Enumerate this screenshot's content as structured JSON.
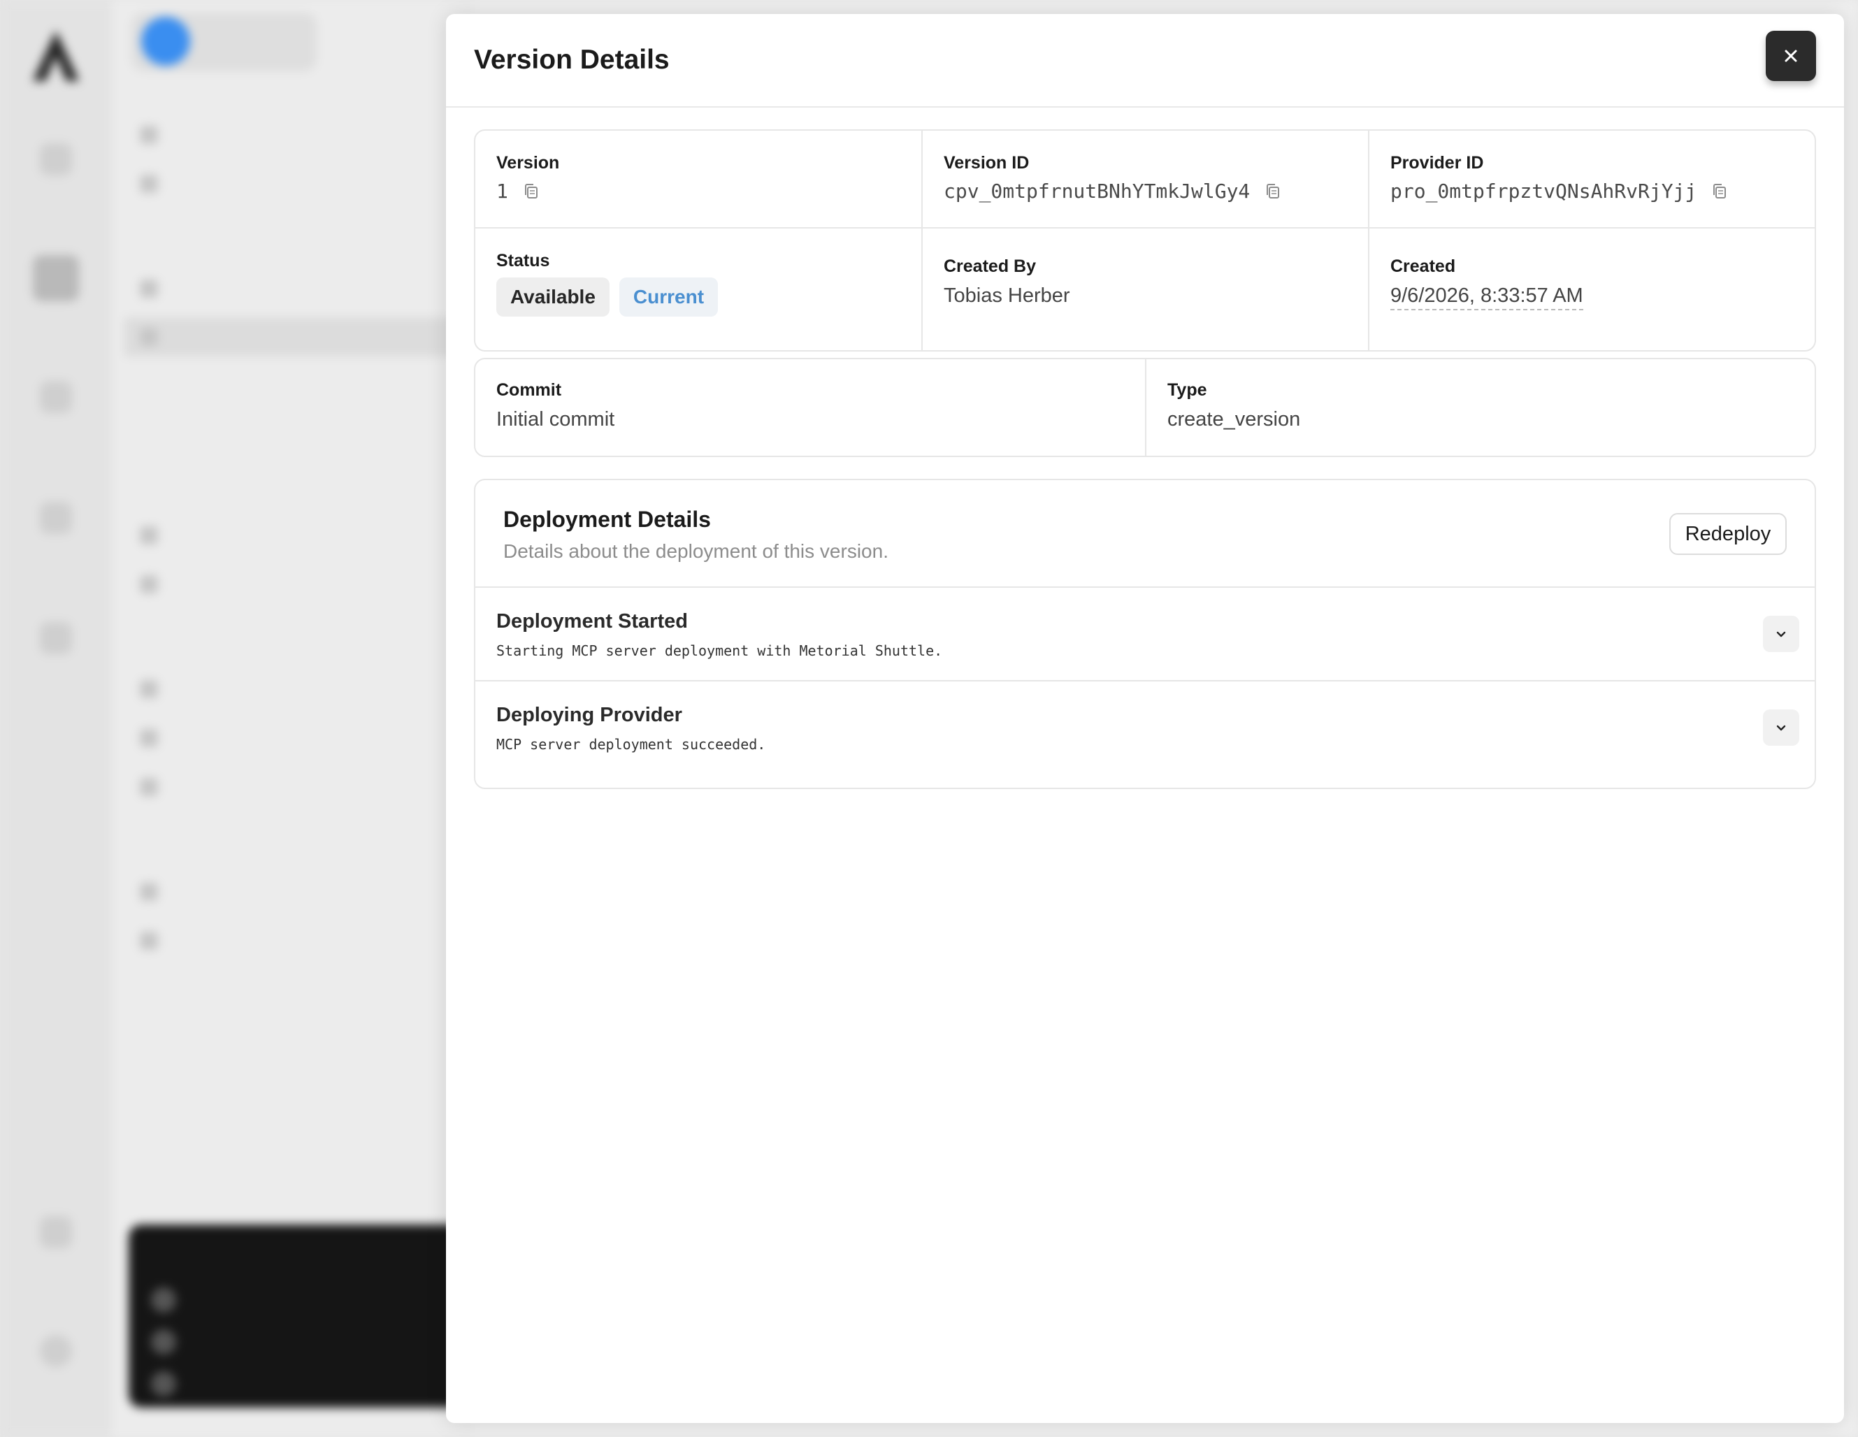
{
  "modal": {
    "title": "Version Details",
    "close_icon": "close-icon"
  },
  "info": {
    "version": {
      "label": "Version",
      "value": "1"
    },
    "version_id": {
      "label": "Version ID",
      "value": "cpv_0mtpfrnutBNhYTmkJwlGy4"
    },
    "provider_id": {
      "label": "Provider ID",
      "value": "pro_0mtpfrpztvQNsAhRvRjYjj"
    },
    "status": {
      "label": "Status",
      "badges": [
        "Available",
        "Current"
      ]
    },
    "created_by": {
      "label": "Created By",
      "value": "Tobias Herber"
    },
    "created": {
      "label": "Created",
      "value": "9/6/2026, 8:33:57 AM"
    },
    "commit": {
      "label": "Commit",
      "value": "Initial commit"
    },
    "type": {
      "label": "Type",
      "value": "create_version"
    }
  },
  "deployment": {
    "title": "Deployment Details",
    "subtitle": "Details about the deployment of this version.",
    "redeploy_label": "Redeploy",
    "steps": [
      {
        "title": "Deployment Started",
        "description": "Starting MCP server deployment with Metorial Shuttle."
      },
      {
        "title": "Deploying Provider",
        "description": "MCP server deployment succeeded."
      }
    ]
  },
  "colors": {
    "accent_blue": "#4a8fd0",
    "close_button": "#2b2b2b",
    "org_avatar": "#3a8ef0"
  }
}
